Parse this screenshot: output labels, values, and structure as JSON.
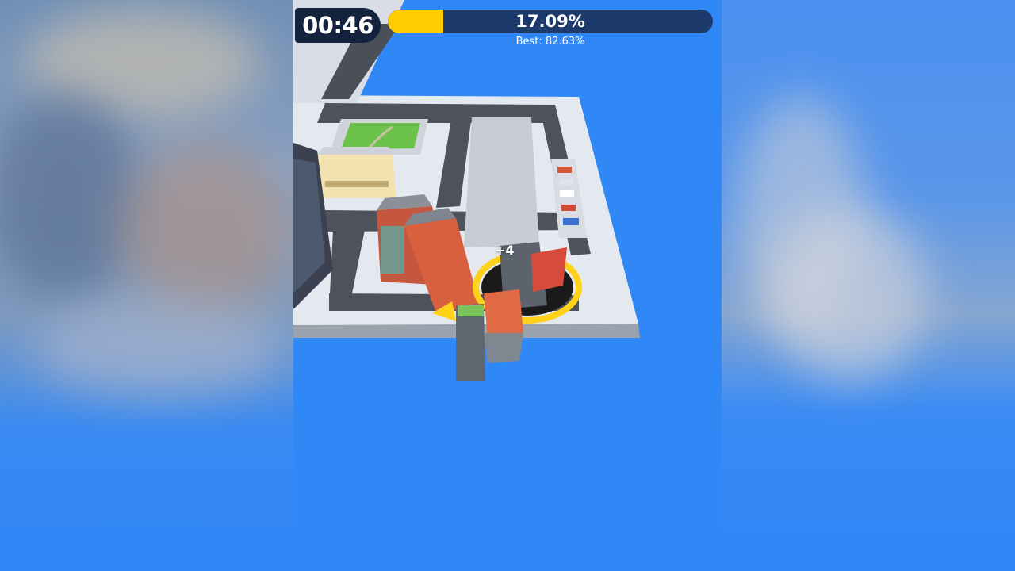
{
  "hud": {
    "timer": "00:46",
    "progress_text": "17.09%",
    "progress_value": 17.09,
    "best_label": "Best: 82.63%"
  },
  "scene": {
    "score_popup": "+4",
    "hole_ring_color": "#ffd21a",
    "background_color": "#2f88f6",
    "items": [
      "city-platform",
      "park",
      "cream-building",
      "brick-buildings",
      "parking-lot",
      "cars",
      "black-hole",
      "tower-building"
    ]
  },
  "colors": {
    "accent_yellow": "#ffcc00",
    "hud_dark": "#13233d",
    "bar_track": "#1c3a6b"
  }
}
